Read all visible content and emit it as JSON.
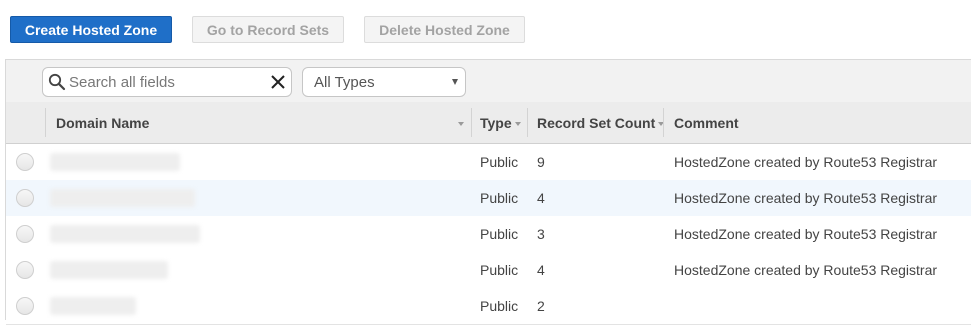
{
  "toolbar": {
    "create_label": "Create Hosted Zone",
    "goto_label": "Go to Record Sets",
    "delete_label": "Delete Hosted Zone"
  },
  "filter": {
    "search_placeholder": "Search all fields",
    "type_selected": "All Types"
  },
  "table": {
    "columns": {
      "domain": "Domain Name",
      "type": "Type",
      "count": "Record Set Count",
      "comment": "Comment"
    },
    "rows": [
      {
        "domain": "",
        "type": "Public",
        "count": "9",
        "comment": "HostedZone created by Route53 Registrar"
      },
      {
        "domain": "",
        "type": "Public",
        "count": "4",
        "comment": "HostedZone created by Route53 Registrar"
      },
      {
        "domain": "",
        "type": "Public",
        "count": "3",
        "comment": "HostedZone created by Route53 Registrar"
      },
      {
        "domain": "",
        "type": "Public",
        "count": "4",
        "comment": "HostedZone created by Route53 Registrar"
      },
      {
        "domain": "",
        "type": "Public",
        "count": "2",
        "comment": ""
      }
    ]
  },
  "icons": {
    "search": "search-icon",
    "clear": "clear-icon",
    "caret": "chevron-down-icon",
    "sort": "sort-icon"
  },
  "colors": {
    "primary": "#1f6fc8",
    "highlight_row": "#f1f7fd"
  }
}
